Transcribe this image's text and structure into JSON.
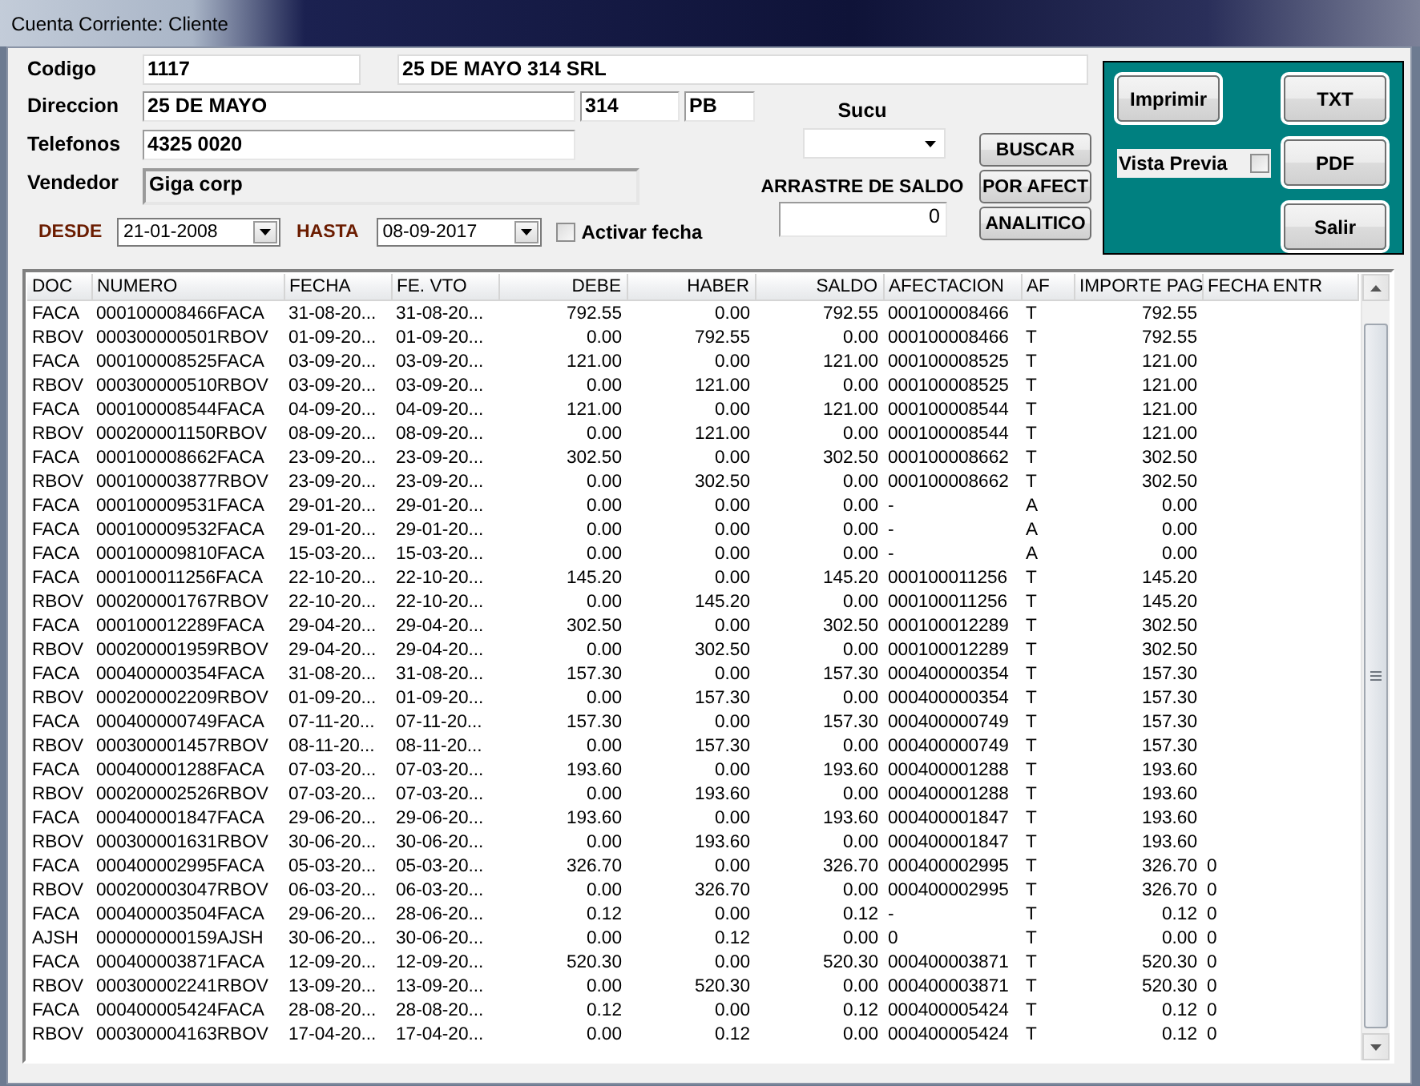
{
  "window": {
    "title": "Cuenta Corriente: Cliente"
  },
  "codigo": {
    "label": "Codigo",
    "value": "1117",
    "name": "25 DE MAYO 314 SRL"
  },
  "direccion": {
    "label": "Direccion",
    "street": "25 DE MAYO",
    "number": "314",
    "floor": "PB"
  },
  "telefonos": {
    "label": "Telefonos",
    "value": "4325 0020"
  },
  "vendedor": {
    "label": "Vendedor",
    "value": "Giga corp",
    "readonly": true
  },
  "sucu": {
    "label": "Sucu"
  },
  "desde": {
    "label": "DESDE",
    "value": "21-01-2008"
  },
  "hasta": {
    "label": "HASTA",
    "value": "08-09-2017"
  },
  "activar_fecha": {
    "label": "Activar fecha",
    "checked": false
  },
  "arrastre_de_saldo": {
    "label": "ARRASTRE DE SALDO",
    "value": "0"
  },
  "buttons": [
    "BUSCAR",
    "POR AFECT",
    "ANALITICO"
  ],
  "print_panel": {
    "imprimir": "Imprimir",
    "vista_previa": {
      "label": "Vista Previa",
      "checked": false
    },
    "buttons": [
      "TXT",
      "PDF",
      "Salir"
    ]
  },
  "table": {
    "columns": [
      "DOC",
      "NUMERO",
      "FECHA",
      "FE. VTO",
      "DEBE",
      "HABER",
      "SALDO",
      "AFECTACION",
      "AF",
      "IMPORTE PAG",
      "FECHA ENTR"
    ],
    "rows": [
      [
        "FACA",
        "000100008466FACA",
        "31-08-20...",
        "31-08-20...",
        "792.55",
        "0.00",
        "792.55",
        "000100008466",
        "T",
        "792.55"
      ],
      [
        "RBOV",
        "000300000501RBOV",
        "01-09-20...",
        "01-09-20...",
        "0.00",
        "792.55",
        "0.00",
        "000100008466",
        "T",
        "792.55"
      ],
      [
        "FACA",
        "000100008525FACA",
        "03-09-20...",
        "03-09-20...",
        "121.00",
        "0.00",
        "121.00",
        "000100008525",
        "T",
        "121.00"
      ],
      [
        "RBOV",
        "000300000510RBOV",
        "03-09-20...",
        "03-09-20...",
        "0.00",
        "121.00",
        "0.00",
        "000100008525",
        "T",
        "121.00"
      ],
      [
        "FACA",
        "000100008544FACA",
        "04-09-20...",
        "04-09-20...",
        "121.00",
        "0.00",
        "121.00",
        "000100008544",
        "T",
        "121.00"
      ],
      [
        "RBOV",
        "000200001150RBOV",
        "08-09-20...",
        "08-09-20...",
        "0.00",
        "121.00",
        "0.00",
        "000100008544",
        "T",
        "121.00"
      ],
      [
        "FACA",
        "000100008662FACA",
        "23-09-20...",
        "23-09-20...",
        "302.50",
        "0.00",
        "302.50",
        "000100008662",
        "T",
        "302.50"
      ],
      [
        "RBOV",
        "000100003877RBOV",
        "23-09-20...",
        "23-09-20...",
        "0.00",
        "302.50",
        "0.00",
        "000100008662",
        "T",
        "302.50"
      ],
      [
        "FACA",
        "000100009531FACA",
        "29-01-20...",
        "29-01-20...",
        "0.00",
        "0.00",
        "0.00",
        "-",
        "A",
        "0.00"
      ],
      [
        "FACA",
        "000100009532FACA",
        "29-01-20...",
        "29-01-20...",
        "0.00",
        "0.00",
        "0.00",
        "-",
        "A",
        "0.00"
      ],
      [
        "FACA",
        "000100009810FACA",
        "15-03-20...",
        "15-03-20...",
        "0.00",
        "0.00",
        "0.00",
        "-",
        "A",
        "0.00"
      ],
      [
        "FACA",
        "000100011256FACA",
        "22-10-20...",
        "22-10-20...",
        "145.20",
        "0.00",
        "145.20",
        "000100011256",
        "T",
        "145.20"
      ],
      [
        "RBOV",
        "000200001767RBOV",
        "22-10-20...",
        "22-10-20...",
        "0.00",
        "145.20",
        "0.00",
        "000100011256",
        "T",
        "145.20"
      ],
      [
        "FACA",
        "000100012289FACA",
        "29-04-20...",
        "29-04-20...",
        "302.50",
        "0.00",
        "302.50",
        "000100012289",
        "T",
        "302.50"
      ],
      [
        "RBOV",
        "000200001959RBOV",
        "29-04-20...",
        "29-04-20...",
        "0.00",
        "302.50",
        "0.00",
        "000100012289",
        "T",
        "302.50"
      ],
      [
        "FACA",
        "000400000354FACA",
        "31-08-20...",
        "31-08-20...",
        "157.30",
        "0.00",
        "157.30",
        "000400000354",
        "T",
        "157.30"
      ],
      [
        "RBOV",
        "000200002209RBOV",
        "01-09-20...",
        "01-09-20...",
        "0.00",
        "157.30",
        "0.00",
        "000400000354",
        "T",
        "157.30"
      ],
      [
        "FACA",
        "000400000749FACA",
        "07-11-20...",
        "07-11-20...",
        "157.30",
        "0.00",
        "157.30",
        "000400000749",
        "T",
        "157.30"
      ],
      [
        "RBOV",
        "000300001457RBOV",
        "08-11-20...",
        "08-11-20...",
        "0.00",
        "157.30",
        "0.00",
        "000400000749",
        "T",
        "157.30"
      ],
      [
        "FACA",
        "000400001288FACA",
        "07-03-20...",
        "07-03-20...",
        "193.60",
        "0.00",
        "193.60",
        "000400001288",
        "T",
        "193.60"
      ],
      [
        "RBOV",
        "000200002526RBOV",
        "07-03-20...",
        "07-03-20...",
        "0.00",
        "193.60",
        "0.00",
        "000400001288",
        "T",
        "193.60"
      ],
      [
        "FACA",
        "000400001847FACA",
        "29-06-20...",
        "29-06-20...",
        "193.60",
        "0.00",
        "193.60",
        "000400001847",
        "T",
        "193.60"
      ],
      [
        "RBOV",
        "000300001631RBOV",
        "30-06-20...",
        "30-06-20...",
        "0.00",
        "193.60",
        "0.00",
        "000400001847",
        "T",
        "193.60"
      ],
      [
        "FACA",
        "000400002995FACA",
        "05-03-20...",
        "05-03-20...",
        "326.70",
        "0.00",
        "326.70",
        "000400002995",
        "T",
        "326.70",
        "0"
      ],
      [
        "RBOV",
        "000200003047RBOV",
        "06-03-20...",
        "06-03-20...",
        "0.00",
        "326.70",
        "0.00",
        "000400002995",
        "T",
        "326.70",
        "0"
      ],
      [
        "FACA",
        "000400003504FACA",
        "29-06-20...",
        "28-06-20...",
        "0.12",
        "0.00",
        "0.12",
        "-",
        "T",
        "0.12",
        "0"
      ],
      [
        "AJSH",
        "000000000159AJSH",
        "30-06-20...",
        "30-06-20...",
        "0.00",
        "0.12",
        "0.00",
        "0",
        "T",
        "0.00",
        "0"
      ],
      [
        "FACA",
        "000400003871FACA",
        "12-09-20...",
        "12-09-20...",
        "520.30",
        "0.00",
        "520.30",
        "000400003871",
        "T",
        "520.30",
        "0"
      ],
      [
        "RBOV",
        "000300002241RBOV",
        "13-09-20...",
        "13-09-20...",
        "0.00",
        "520.30",
        "0.00",
        "000400003871",
        "T",
        "520.30",
        "0"
      ],
      [
        "FACA",
        "000400005424FACA",
        "28-08-20...",
        "28-08-20...",
        "0.12",
        "0.00",
        "0.12",
        "000400005424",
        "T",
        "0.12",
        "0"
      ],
      [
        "RBOV",
        "000300004163RBOV",
        "17-04-20...",
        "17-04-20...",
        "0.00",
        "0.12",
        "0.00",
        "000400005424",
        "T",
        "0.12",
        "0"
      ]
    ]
  }
}
